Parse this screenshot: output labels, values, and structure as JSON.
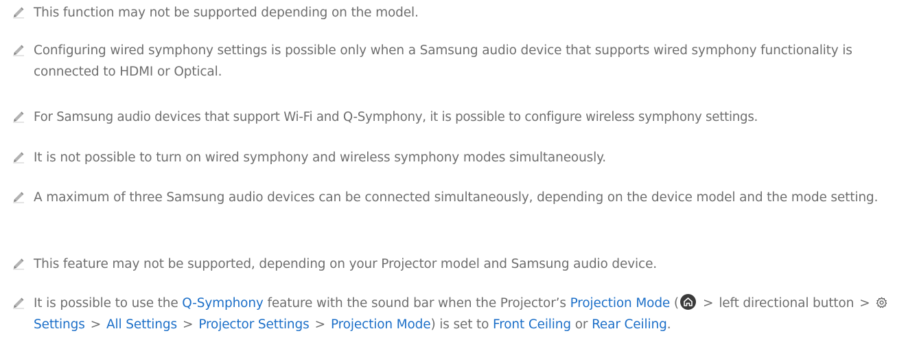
{
  "notes": [
    {
      "text": "This function may not be supported depending on the model."
    },
    {
      "text": "Configuring wired symphony settings is possible only when a Samsung audio device that supports wired symphony functionality is connected to HDMI or Optical."
    },
    {
      "text": "For Samsung audio devices that support Wi-Fi and Q-Symphony, it is possible to configure wireless symphony settings."
    },
    {
      "text": "It is not possible to turn on wired symphony and wireless symphony modes simultaneously."
    },
    {
      "text": "A maximum of three Samsung audio devices can be connected simultaneously, depending on the device model and the mode setting."
    },
    {
      "text": "This feature may not be supported, depending on your Projector model and Samsung audio device."
    }
  ],
  "last_note": {
    "t1": "It is possible to use the ",
    "q_symphony": "Q-Symphony",
    "t2": " feature with the sound bar when the Projector’s ",
    "projection_mode": "Projection Mode",
    "t3": " (",
    "sep": ">",
    "left_button": "left directional button",
    "settings": "Settings",
    "all_settings": "All Settings",
    "projector_settings": "Projector Settings",
    "projection_mode_2": "Projection Mode",
    "t4": ") is set to ",
    "front_ceiling": "Front Ceiling",
    "t5": " or ",
    "rear_ceiling": "Rear Ceiling",
    "t6": "."
  },
  "colors": {
    "body_text": "#6e6e6e",
    "link_text": "#1c6fc8",
    "pencil_icon": "#a8a8a8",
    "home_button": "#3a3a3a"
  },
  "icons": {
    "note": "pencil-icon",
    "home": "home-button-icon",
    "settings": "gear-icon"
  }
}
